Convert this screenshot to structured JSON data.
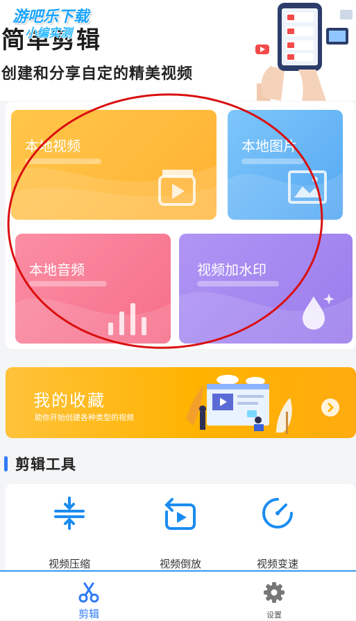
{
  "watermark": {
    "line1": "游吧乐下载",
    "line2": "小编实测"
  },
  "header": {
    "title": "简单剪辑",
    "subtitle": "创建和分享自定的精美视频"
  },
  "features": [
    {
      "label": "本地视频",
      "icon": "film-clapper-icon",
      "color": "#ffbf3f"
    },
    {
      "label": "本地图片",
      "icon": "picture-frame-icon",
      "color": "#5fb2f4"
    },
    {
      "label": "本地音频",
      "icon": "audio-bars-icon",
      "color": "#f97d96"
    },
    {
      "label": "视频加水印",
      "icon": "water-drop-icon",
      "color": "#9e83ee"
    }
  ],
  "collection": {
    "title": "我的收藏",
    "subtitle": "助你开始创建各种类型的视频",
    "arrow_icon": "chevron-right-icon"
  },
  "tools_section": {
    "title": "剪辑工具",
    "tools": [
      {
        "label": "视频压缩",
        "icon": "compress-icon"
      },
      {
        "label": "视频倒放",
        "icon": "reverse-play-icon"
      },
      {
        "label": "视频变速",
        "icon": "speed-gauge-icon"
      }
    ]
  },
  "tabbar": {
    "tabs": [
      {
        "label": "剪辑",
        "icon": "scissors-icon",
        "active": true
      },
      {
        "label": "设置",
        "icon": "gear-icon",
        "active": false
      }
    ]
  },
  "colors": {
    "accent": "#2f7bf6",
    "annotation": "#d90f0f"
  }
}
